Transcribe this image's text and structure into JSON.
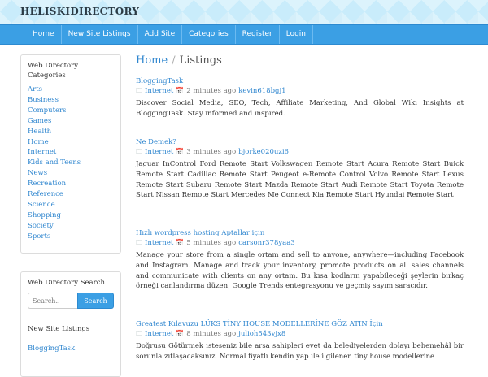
{
  "site": {
    "title": "HELISKIDIRECTORY"
  },
  "nav": {
    "items": [
      {
        "label": "Home"
      },
      {
        "label": "New Site Listings"
      },
      {
        "label": "Add Site"
      },
      {
        "label": "Categories"
      },
      {
        "label": "Register"
      },
      {
        "label": "Login"
      }
    ]
  },
  "sidebar": {
    "categories_heading": "Web Directory Categories",
    "categories": [
      "Arts",
      "Business",
      "Computers",
      "Games",
      "Health",
      "Home",
      "Internet",
      "Kids and Teens",
      "News",
      "Recreation",
      "Reference",
      "Science",
      "Shopping",
      "Society",
      "Sports"
    ],
    "search_heading": "Web Directory Search",
    "search_placeholder": "Search..",
    "search_button": "Search",
    "new_listings_heading": "New Site Listings",
    "new_listings": [
      "BloggingTask"
    ]
  },
  "breadcrumb": {
    "home": "Home",
    "separator": "/",
    "current": "Listings"
  },
  "listings": [
    {
      "title": "BloggingTask",
      "category": "Internet",
      "time": "2 minutes ago",
      "user": "kevin618bgj1",
      "description": "Discover Social Media, SEO, Tech, Affiliate Marketing, And Global Wiki Insights at BloggingTask. Stay informed and inspired."
    },
    {
      "title": "Ne Demek?",
      "category": "Internet",
      "time": "3 minutes ago",
      "user": "bjorke020uzi6",
      "description": "Jaguar InControl Ford Remote Start Volkswagen Remote Start Acura Remote Start Buick Remote Start Cadillac Remote Start Peugeot e-Remote Control Volvo Remote Start Lexus Remote Start Subaru Remote Start Mazda Remote Start Audi Remote Start Toyota Remote Start Nissan Remote Start Mercedes Me Connect Kia Remote Start Hyundai Remote Start"
    },
    {
      "title": "Hızlı wordpress hosting Aptallar için",
      "category": "Internet",
      "time": "5 minutes ago",
      "user": "carsonr378yaa3",
      "description": "Manage your store from a single ortam and sell to anyone, anywhere—including Facebook and Instagram. Manage and track your inventory, promote products on all sales channels and communicate with clients on any ortam. Bu kısa kodların yapabileceği şeylerin birkaç örneği canlandırma düzen, Google Trends entegrasyonu ve geçmiş sayım saracıdır."
    },
    {
      "title": "Greatest Kılavuzu LÜKS TİNY HOUSE MODELLERİNE GÖZ ATIN İçin",
      "category": "Internet",
      "time": "8 minutes ago",
      "user": "julioh543vjx8",
      "description": "Doğrusu Götürmek isteseniz bile arsa sahipleri evet da belediyelerden dolayı behemehâl bir sorunla zıtlaşacaksınız. Normal fiyatlı kendin yap ile ilgilenen tiny house modellerine"
    }
  ],
  "colors": {
    "accent": "#3b9fe4",
    "link": "#2f86cf"
  }
}
